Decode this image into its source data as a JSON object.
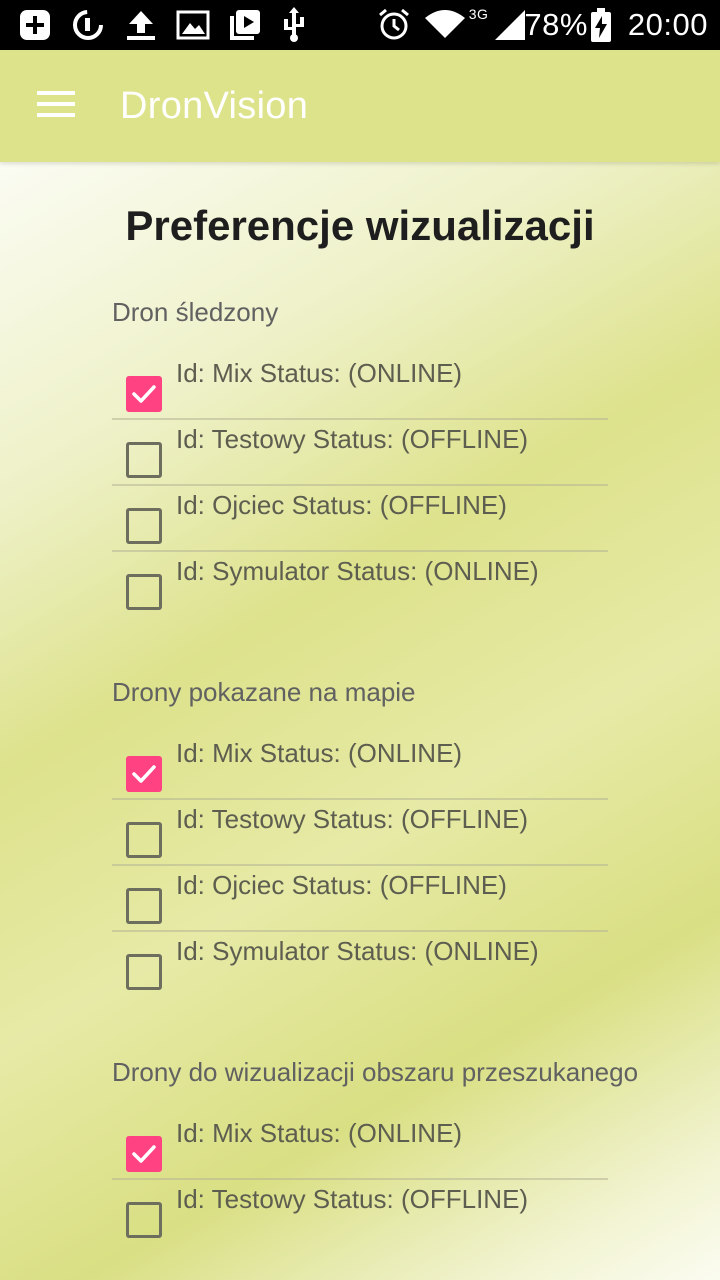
{
  "status_bar": {
    "battery": "78%",
    "time": "20:00",
    "network": "3G",
    "icons": [
      "add-box-icon",
      "sync-icon",
      "upload-icon",
      "image-icon",
      "video-library-icon",
      "usb-icon",
      "alarm-icon",
      "wifi-icon",
      "signal-icon",
      "battery-charging-icon"
    ]
  },
  "app_bar": {
    "menu_icon": "menu-icon",
    "title": "DronVision"
  },
  "page": {
    "title": "Preferencje wizualizacji"
  },
  "sections": [
    {
      "header": "Dron śledzony",
      "items": [
        {
          "label": "Id: Mix Status: (ONLINE)",
          "checked": true
        },
        {
          "label": "Id: Testowy Status: (OFFLINE)",
          "checked": false
        },
        {
          "label": "Id: Ojciec Status: (OFFLINE)",
          "checked": false
        },
        {
          "label": "Id: Symulator Status: (ONLINE)",
          "checked": false
        }
      ]
    },
    {
      "header": "Drony pokazane na mapie",
      "items": [
        {
          "label": "Id: Mix Status: (ONLINE)",
          "checked": true
        },
        {
          "label": "Id: Testowy Status: (OFFLINE)",
          "checked": false
        },
        {
          "label": "Id: Ojciec Status: (OFFLINE)",
          "checked": false
        },
        {
          "label": "Id: Symulator Status: (ONLINE)",
          "checked": false
        }
      ]
    },
    {
      "header": "Drony do wizualizacji obszaru przeszukanego",
      "items": [
        {
          "label": "Id: Mix Status: (ONLINE)",
          "checked": true
        },
        {
          "label": "Id: Testowy Status: (OFFLINE)",
          "checked": false
        }
      ]
    }
  ],
  "colors": {
    "app_bar": "#dde38a",
    "accent_checked": "#ff4281",
    "text_primary": "#1e1e1e",
    "text_secondary": "#616161"
  }
}
